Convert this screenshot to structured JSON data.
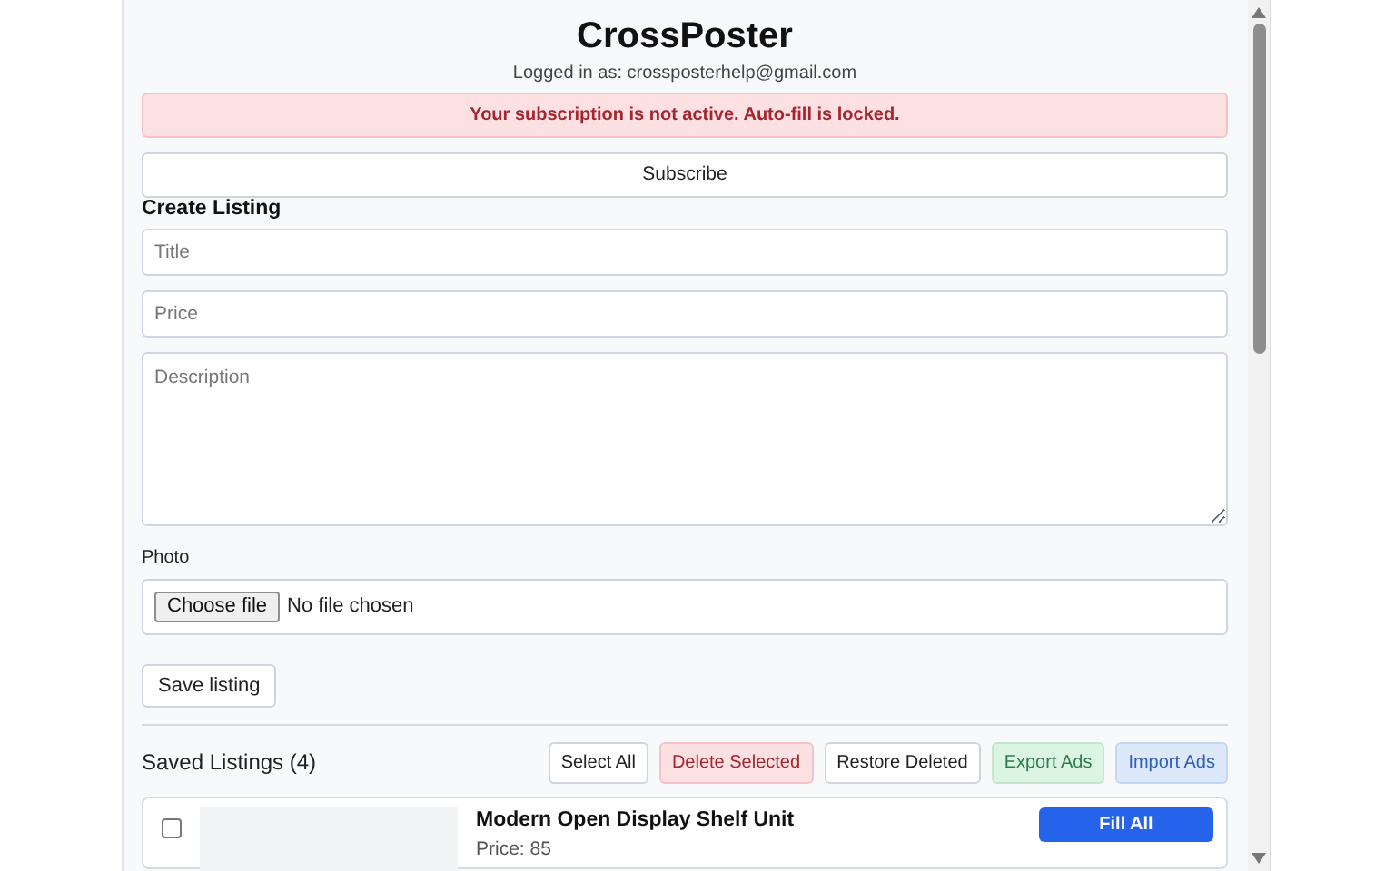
{
  "header": {
    "title": "CrossPoster",
    "login_text": "Logged in as: crossposterhelp@gmail.com"
  },
  "alert": {
    "text": "Your subscription is not active. Auto-fill is locked."
  },
  "subscribe_button": "Subscribe",
  "create_listing": {
    "heading": "Create Listing",
    "fields": [
      {
        "kind": "input",
        "placeholder": "Title"
      },
      {
        "kind": "input",
        "placeholder": "Price"
      },
      {
        "kind": "textarea",
        "placeholder": "Description"
      }
    ],
    "photo_label": "Photo",
    "file_button": "Choose file",
    "file_status": "No file chosen",
    "save_button": "Save listing"
  },
  "saved_listings": {
    "heading": "Saved Listings (4)",
    "actions": [
      {
        "label": "Select All",
        "kind": "plain"
      },
      {
        "label": "Delete Selected",
        "kind": "danger"
      },
      {
        "label": "Restore Deleted",
        "kind": "plain"
      },
      {
        "label": "Export Ads",
        "kind": "success"
      },
      {
        "label": "Import Ads",
        "kind": "info"
      }
    ],
    "items": [
      {
        "title": "Modern Open Display Shelf Unit",
        "price": "Price: 85",
        "checked": false,
        "button": "Fill All"
      }
    ]
  }
}
